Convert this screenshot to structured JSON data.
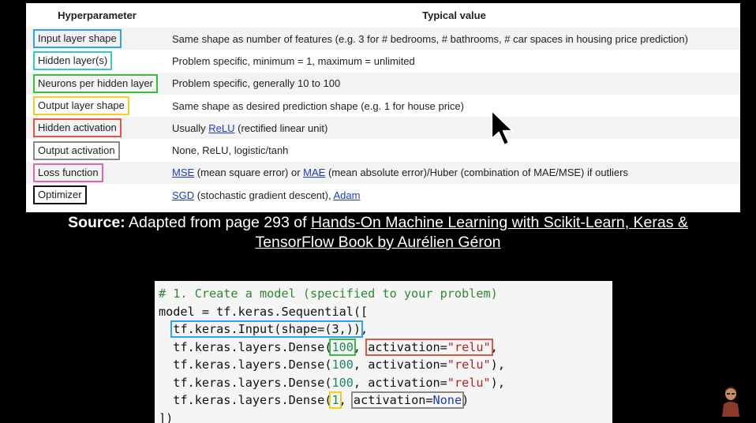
{
  "table": {
    "header": {
      "col1": "Hyperparameter",
      "col2": "Typical value"
    },
    "rows": [
      {
        "param": "Input layer shape",
        "value": "Same shape as number of features (e.g. 3 for # bedrooms, # bathrooms, # car spaces in housing price prediction)",
        "color": "#2ea3e6"
      },
      {
        "param": "Hidden layer(s)",
        "value": "Problem specific, minimum = 1, maximum = unlimited",
        "color": "#37c9c3"
      },
      {
        "param": "Neurons per hidden layer",
        "value": "Problem specific, generally 10 to 100",
        "color": "#3dbb3d"
      },
      {
        "param": "Output layer shape",
        "value": "Same shape as desired prediction shape (e.g. 1 for house price)",
        "color": "#f0d020"
      },
      {
        "param": "Hidden activation",
        "value_link": "ReLU",
        "value_rest": " (rectified linear unit)",
        "value_prefix": "Usually ",
        "color": "#e0574a"
      },
      {
        "param": "Output activation",
        "value": "None, ReLU, logistic/tanh",
        "color": "#8a8a8a"
      },
      {
        "param": "Loss function",
        "link1": "MSE",
        "mid": " (mean square error) or ",
        "link2": "MAE",
        "rest": " (mean absolute error)/Huber (combination of MAE/MSE) if outliers",
        "color": "#e066b0"
      },
      {
        "param": "Optimizer",
        "link1": "SGD",
        "mid": " (stochastic gradient descent), ",
        "link2": "Adam",
        "color": "#111111"
      }
    ]
  },
  "source": {
    "label": "Source:",
    "pre": " Adapted from page 293 of ",
    "book_line1": "Hands-On Machine Learning with Scikit-Learn, Keras &",
    "book_line2": "TensorFlow Book by Aurélien Géron"
  },
  "code": {
    "comment": "# 1. Create a model (specified to your problem)",
    "line1": "model = tf.keras.Sequential([",
    "input_call": "tf.keras.Input(shape=(3,))",
    "dense_prefix": "tf.keras.layers.Dense(",
    "neurons": "100",
    "activation_kw": "activation=",
    "relu": "\"relu\"",
    "out_units": "1",
    "out_activation_kw": "activation=",
    "none_kw": "None",
    "close": "])"
  }
}
